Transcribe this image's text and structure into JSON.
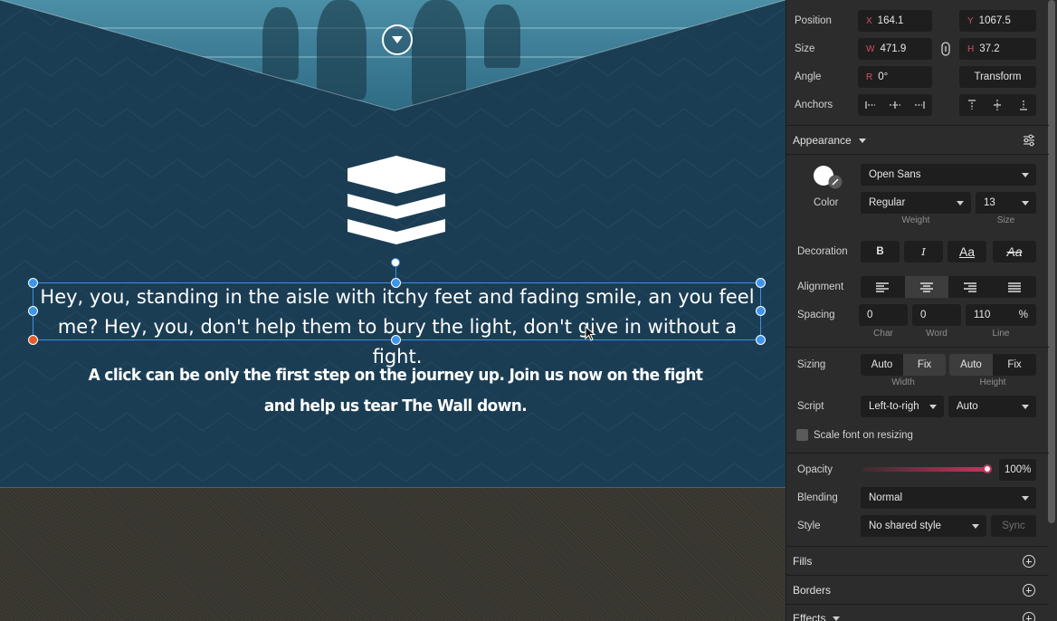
{
  "canvas": {
    "body_text": "Hey, you, standing in the aisle with itchy feet and fading smile, an you feel me? Hey, you, don't help them to bury the light, don't give in without a fight.",
    "cta_text": "A click can be only the first step on the journey up. Join us now on the fight and help us tear The Wall down.",
    "colors": {
      "navy": "#1b3d54",
      "selection": "#3e8ee6",
      "handle_red": "#e55c2a"
    }
  },
  "inspector": {
    "position": {
      "label": "Position",
      "x_prefix": "X",
      "x": "164.1",
      "y_prefix": "Y",
      "y": "1067.5"
    },
    "size": {
      "label": "Size",
      "w_prefix": "W",
      "w": "471.9",
      "h_prefix": "H",
      "h": "37.2"
    },
    "angle": {
      "label": "Angle",
      "prefix": "R",
      "value": "0°",
      "transform_label": "Transform"
    },
    "anchors": {
      "label": "Anchors"
    },
    "appearance": {
      "label": "Appearance"
    },
    "text": {
      "color_label": "Color",
      "font": "Open Sans",
      "weight": "Regular",
      "weight_label": "Weight",
      "size": "13",
      "size_label": "Size",
      "decoration_label": "Decoration",
      "bold": "B",
      "italic": "I",
      "caps": "Aa",
      "strike": "Aa",
      "alignment_label": "Alignment",
      "spacing_label": "Spacing",
      "char": "0",
      "char_label": "Char",
      "word": "0",
      "word_label": "Word",
      "line": "110",
      "line_unit": "%",
      "line_label": "Line",
      "sizing_label": "Sizing",
      "width_auto": "Auto",
      "width_fix": "Fix",
      "width_label": "Width",
      "height_auto": "Auto",
      "height_fix": "Fix",
      "height_label": "Height",
      "script_label": "Script",
      "script_dir": "Left-to-righ",
      "script_lang": "Auto",
      "scale_font": "Scale font on resizing"
    },
    "opacity": {
      "label": "Opacity",
      "value": "100%",
      "level": 1.0
    },
    "blending": {
      "label": "Blending",
      "value": "Normal"
    },
    "style": {
      "label": "Style",
      "value": "No shared style",
      "sync": "Sync"
    },
    "fills": {
      "label": "Fills"
    },
    "borders": {
      "label": "Borders"
    },
    "effects": {
      "label": "Effects"
    }
  }
}
